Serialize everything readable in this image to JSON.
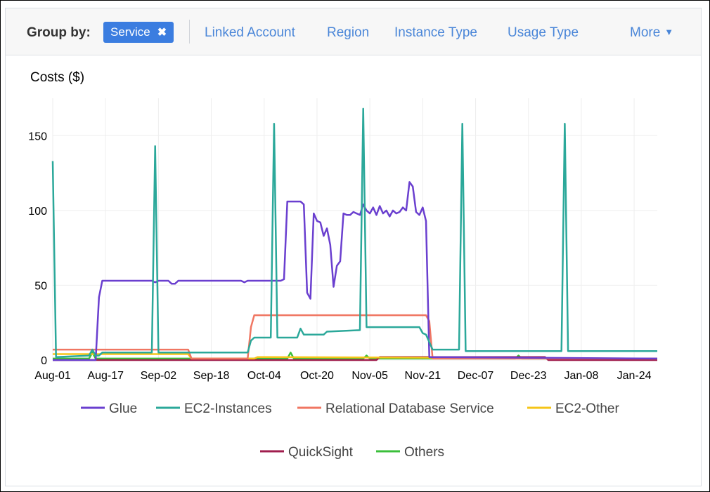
{
  "toolbar": {
    "group_by_label": "Group by:",
    "chip_label": "Service",
    "chip_remove_icon": "close-icon",
    "tabs": [
      "Linked Account",
      "Region",
      "Instance Type",
      "Usage Type"
    ],
    "more_label": "More",
    "more_icon": "caret-down-icon"
  },
  "colors": {
    "chip_bg": "#3b7de0",
    "link": "#4a86d8"
  },
  "chart_data": {
    "type": "line",
    "ylabel": "Costs ($)",
    "ylim": [
      0,
      175
    ],
    "yticks": [
      0,
      50,
      100,
      150
    ],
    "x_start": "Aug-01",
    "x_end": "Jan-31",
    "xticks": [
      "Aug-01",
      "Aug-17",
      "Sep-02",
      "Sep-18",
      "Oct-04",
      "Oct-20",
      "Nov-05",
      "Nov-21",
      "Dec-07",
      "Dec-23",
      "Jan-08",
      "Jan-24"
    ],
    "grid": true,
    "legend_position": "bottom",
    "series": [
      {
        "name": "Glue",
        "color": "#6a3fcf",
        "points": [
          [
            "Aug-01",
            0
          ],
          [
            "Aug-14",
            0
          ],
          [
            "Aug-15",
            42
          ],
          [
            "Aug-16",
            53
          ],
          [
            "Aug-31",
            53
          ],
          [
            "Sep-01",
            52
          ],
          [
            "Sep-02",
            53
          ],
          [
            "Sep-05",
            53
          ],
          [
            "Sep-06",
            51
          ],
          [
            "Sep-07",
            51
          ],
          [
            "Sep-08",
            53
          ],
          [
            "Sep-27",
            53
          ],
          [
            "Sep-28",
            52
          ],
          [
            "Sep-29",
            53
          ],
          [
            "Oct-09",
            53
          ],
          [
            "Oct-10",
            54
          ],
          [
            "Oct-11",
            106
          ],
          [
            "Oct-15",
            106
          ],
          [
            "Oct-16",
            104
          ],
          [
            "Oct-17",
            45
          ],
          [
            "Oct-18",
            41
          ],
          [
            "Oct-19",
            98
          ],
          [
            "Oct-20",
            93
          ],
          [
            "Oct-21",
            92
          ],
          [
            "Oct-22",
            83
          ],
          [
            "Oct-23",
            88
          ],
          [
            "Oct-24",
            77
          ],
          [
            "Oct-25",
            49
          ],
          [
            "Oct-26",
            63
          ],
          [
            "Oct-27",
            66
          ],
          [
            "Oct-28",
            98
          ],
          [
            "Oct-29",
            97
          ],
          [
            "Oct-30",
            97
          ],
          [
            "Oct-31",
            99
          ],
          [
            "Nov-01",
            98
          ],
          [
            "Nov-02",
            97
          ],
          [
            "Nov-03",
            104
          ],
          [
            "Nov-04",
            100
          ],
          [
            "Nov-05",
            98
          ],
          [
            "Nov-06",
            102
          ],
          [
            "Nov-07",
            97
          ],
          [
            "Nov-08",
            103
          ],
          [
            "Nov-09",
            98
          ],
          [
            "Nov-10",
            100
          ],
          [
            "Nov-11",
            96
          ],
          [
            "Nov-12",
            100
          ],
          [
            "Nov-13",
            98
          ],
          [
            "Nov-14",
            99
          ],
          [
            "Nov-15",
            102
          ],
          [
            "Nov-16",
            100
          ],
          [
            "Nov-17",
            119
          ],
          [
            "Nov-18",
            116
          ],
          [
            "Nov-19",
            99
          ],
          [
            "Nov-20",
            97
          ],
          [
            "Nov-21",
            102
          ],
          [
            "Nov-22",
            93
          ],
          [
            "Nov-23",
            2
          ],
          [
            "Jan-31",
            1
          ]
        ]
      },
      {
        "name": "EC2-Instances",
        "color": "#2ba89a",
        "points": [
          [
            "Aug-01",
            133
          ],
          [
            "Aug-02",
            2
          ],
          [
            "Aug-12",
            3
          ],
          [
            "Aug-13",
            7
          ],
          [
            "Aug-14",
            3
          ],
          [
            "Aug-15",
            3
          ],
          [
            "Aug-16",
            5
          ],
          [
            "Aug-31",
            5
          ],
          [
            "Sep-01",
            143
          ],
          [
            "Sep-02",
            5
          ],
          [
            "Sep-28",
            5
          ],
          [
            "Sep-29",
            5
          ],
          [
            "Sep-30",
            13
          ],
          [
            "Oct-01",
            15
          ],
          [
            "Oct-06",
            15
          ],
          [
            "Oct-07",
            158
          ],
          [
            "Oct-08",
            15
          ],
          [
            "Oct-14",
            15
          ],
          [
            "Oct-15",
            21
          ],
          [
            "Oct-16",
            17
          ],
          [
            "Oct-22",
            17
          ],
          [
            "Oct-23",
            19
          ],
          [
            "Nov-02",
            20
          ],
          [
            "Nov-03",
            168
          ],
          [
            "Nov-04",
            22
          ],
          [
            "Nov-13",
            22
          ],
          [
            "Nov-19",
            22
          ],
          [
            "Nov-20",
            22
          ],
          [
            "Nov-21",
            18
          ],
          [
            "Nov-22",
            17
          ],
          [
            "Nov-24",
            7
          ],
          [
            "Dec-02",
            7
          ],
          [
            "Dec-03",
            158
          ],
          [
            "Dec-04",
            6
          ],
          [
            "Dec-06",
            6
          ],
          [
            "Jan-02",
            6
          ],
          [
            "Jan-03",
            158
          ],
          [
            "Jan-04",
            6
          ],
          [
            "Jan-31",
            6
          ]
        ]
      },
      {
        "name": "Relational Database Service",
        "color": "#f07662",
        "points": [
          [
            "Aug-01",
            7
          ],
          [
            "Sep-11",
            7
          ],
          [
            "Sep-12",
            1
          ],
          [
            "Sep-29",
            1
          ],
          [
            "Sep-30",
            22
          ],
          [
            "Oct-01",
            30
          ],
          [
            "Nov-22",
            30
          ],
          [
            "Nov-23",
            26
          ],
          [
            "Nov-24",
            1
          ],
          [
            "Jan-31",
            1
          ]
        ]
      },
      {
        "name": "EC2-Other",
        "color": "#f5c518",
        "points": [
          [
            "Aug-01",
            4
          ],
          [
            "Sep-11",
            4
          ],
          [
            "Sep-12",
            1
          ],
          [
            "Oct-01",
            1
          ],
          [
            "Oct-02",
            2
          ],
          [
            "Jan-31",
            1
          ]
        ]
      },
      {
        "name": "QuickSight",
        "color": "#a01e4e",
        "points": [
          [
            "Aug-01",
            0
          ],
          [
            "Nov-07",
            0
          ],
          [
            "Nov-08",
            2
          ],
          [
            "Dec-28",
            2
          ],
          [
            "Dec-29",
            0
          ],
          [
            "Jan-31",
            0
          ]
        ]
      },
      {
        "name": "Others",
        "color": "#3bbf3b",
        "points": [
          [
            "Aug-01",
            1
          ],
          [
            "Aug-12",
            1
          ],
          [
            "Aug-13",
            5
          ],
          [
            "Aug-14",
            1
          ],
          [
            "Oct-11",
            1
          ],
          [
            "Oct-12",
            5
          ],
          [
            "Oct-13",
            1
          ],
          [
            "Nov-03",
            1
          ],
          [
            "Nov-04",
            3
          ],
          [
            "Nov-05",
            1
          ],
          [
            "Dec-19",
            1
          ],
          [
            "Dec-20",
            3
          ],
          [
            "Dec-21",
            1
          ],
          [
            "Jan-31",
            1
          ]
        ]
      }
    ]
  }
}
